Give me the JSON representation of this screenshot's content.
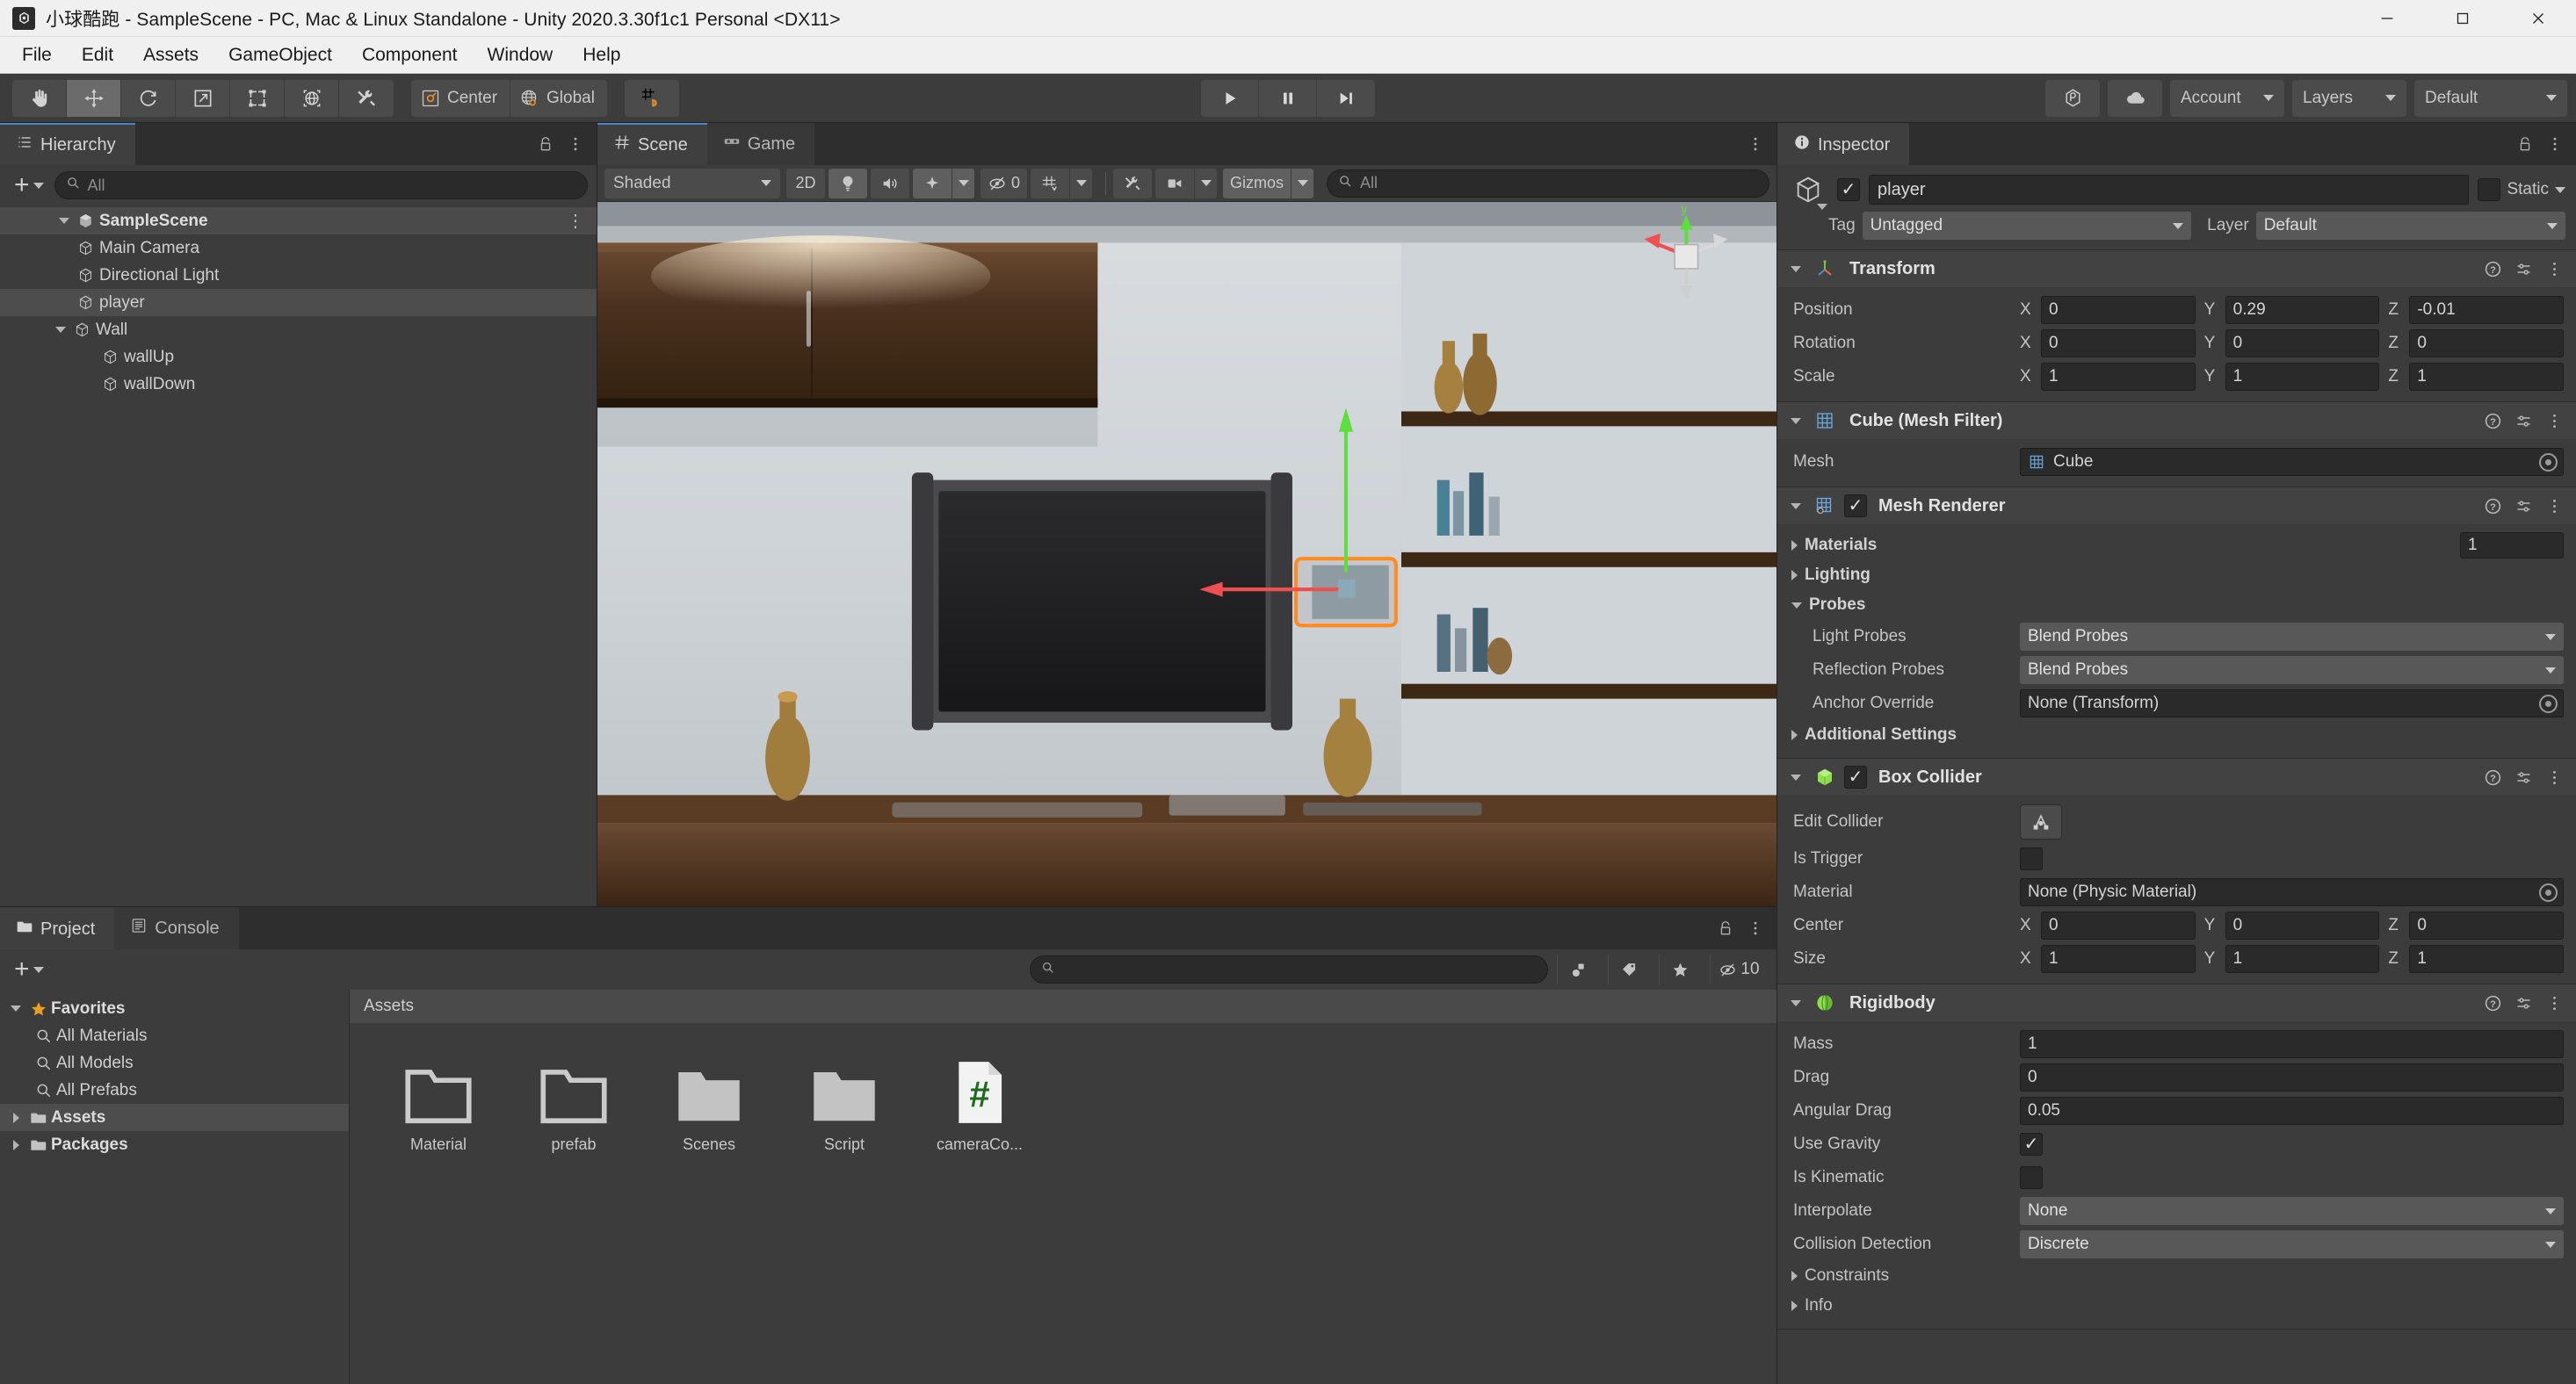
{
  "window": {
    "title": "小球酷跑 - SampleScene - PC, Mac & Linux Standalone - Unity 2020.3.30f1c1 Personal <DX11>",
    "app_icon": "unity-icon",
    "minimize": "minimize-icon",
    "maximize": "maximize-icon",
    "close": "close-icon"
  },
  "menubar": {
    "items": [
      "File",
      "Edit",
      "Assets",
      "GameObject",
      "Component",
      "Window",
      "Help"
    ]
  },
  "toolbar": {
    "tools": [
      {
        "name": "hand-tool",
        "active": false
      },
      {
        "name": "move-tool",
        "active": true
      },
      {
        "name": "rotate-tool",
        "active": false
      },
      {
        "name": "scale-tool",
        "active": false
      },
      {
        "name": "rect-tool",
        "active": false
      },
      {
        "name": "transform-tool",
        "active": false
      },
      {
        "name": "custom-editor-tool",
        "active": false
      }
    ],
    "pivot_label": "Center",
    "space_label": "Global",
    "snap_label": "grid-snap",
    "play": "play-icon",
    "pause": "pause-icon",
    "step": "step-icon",
    "collab_label": "collab-icon",
    "cloud_label": "cloud-icon",
    "account_label": "Account",
    "layers_label": "Layers",
    "layout_label": "Default"
  },
  "hierarchy": {
    "tab_label": "Hierarchy",
    "search_placeholder": "All",
    "rows": [
      {
        "label": "SampleScene",
        "depth": 0,
        "type": "scene",
        "expanded": true,
        "selected": false,
        "menu": true
      },
      {
        "label": "Main Camera",
        "depth": 1,
        "type": "object",
        "expanded": null,
        "selected": false
      },
      {
        "label": "Directional Light",
        "depth": 1,
        "type": "object",
        "expanded": null,
        "selected": false
      },
      {
        "label": "player",
        "depth": 1,
        "type": "object",
        "expanded": null,
        "selected": true
      },
      {
        "label": "Wall",
        "depth": 1,
        "type": "object",
        "expanded": true,
        "selected": false
      },
      {
        "label": "wallUp",
        "depth": 2,
        "type": "object",
        "expanded": null,
        "selected": false
      },
      {
        "label": "wallDown",
        "depth": 2,
        "type": "object",
        "expanded": null,
        "selected": false
      }
    ]
  },
  "scene": {
    "tabs": [
      {
        "label": "Scene",
        "icon": "scene-grid-icon",
        "active": true
      },
      {
        "label": "Game",
        "icon": "game-pad-icon",
        "active": false
      }
    ],
    "draw_mode": "Shaded",
    "two_d_label": "2D",
    "lighting_icon": "lighting-bulb-icon",
    "audio_icon": "audio-speaker-icon",
    "fx_icon": "effects-icon",
    "hidden_count": "0",
    "grid_icon": "grid-visibility-icon",
    "tools_icon": "scene-tools-icon",
    "camera_icon": "scene-camera-icon",
    "gizmos_label": "Gizmos",
    "search_placeholder": "All"
  },
  "project": {
    "tabs": [
      {
        "label": "Project",
        "icon": "folder-icon",
        "active": true
      },
      {
        "label": "Console",
        "icon": "console-icon",
        "active": false
      }
    ],
    "search_placeholder": "",
    "hidden_count": "10",
    "tree": [
      {
        "label": "Favorites",
        "depth": 0,
        "icon": "star-icon",
        "expanded": true,
        "bold": true,
        "selected": false
      },
      {
        "label": "All Materials",
        "depth": 1,
        "icon": "search-icon",
        "expanded": null,
        "bold": false,
        "selected": false
      },
      {
        "label": "All Models",
        "depth": 1,
        "icon": "search-icon",
        "expanded": null,
        "bold": false,
        "selected": false
      },
      {
        "label": "All Prefabs",
        "depth": 1,
        "icon": "search-icon",
        "expanded": null,
        "bold": false,
        "selected": false
      },
      {
        "label": "Assets",
        "depth": 0,
        "icon": "folder-icon",
        "expanded": false,
        "bold": true,
        "selected": true
      },
      {
        "label": "Packages",
        "depth": 0,
        "icon": "folder-icon",
        "expanded": false,
        "bold": true,
        "selected": false
      }
    ],
    "breadcrumb": "Assets",
    "assets": [
      {
        "label": "Material",
        "type": "folder-empty"
      },
      {
        "label": "prefab",
        "type": "folder-empty"
      },
      {
        "label": "Scenes",
        "type": "folder-full"
      },
      {
        "label": "Script",
        "type": "folder-full"
      },
      {
        "label": "cameraCo...",
        "type": "csharp-script"
      }
    ]
  },
  "inspector": {
    "tab_label": "Inspector",
    "object_enabled": true,
    "object_name": "player",
    "static_label": "Static",
    "static_checked": false,
    "tag_label": "Tag",
    "tag_value": "Untagged",
    "layer_label": "Layer",
    "layer_value": "Default",
    "components": [
      {
        "name": "Transform",
        "icon": "transform-icon",
        "has_checkbox": false,
        "expanded": true,
        "vectors": [
          {
            "label": "Position",
            "x": "0",
            "y": "0.29",
            "z": "-0.01"
          },
          {
            "label": "Rotation",
            "x": "0",
            "y": "0",
            "z": "0"
          },
          {
            "label": "Scale",
            "x": "1",
            "y": "1",
            "z": "1"
          }
        ]
      },
      {
        "name": "Cube (Mesh Filter)",
        "icon": "mesh-filter-icon",
        "has_checkbox": false,
        "expanded": true,
        "mesh_label": "Mesh",
        "mesh_value": "Cube"
      },
      {
        "name": "Mesh Renderer",
        "icon": "mesh-renderer-icon",
        "has_checkbox": true,
        "checked": true,
        "expanded": true,
        "materials_label": "Materials",
        "materials_count": "1",
        "lighting_label": "Lighting",
        "probes_label": "Probes",
        "light_probes_label": "Light Probes",
        "light_probes_value": "Blend Probes",
        "reflection_probes_label": "Reflection Probes",
        "reflection_probes_value": "Blend Probes",
        "anchor_label": "Anchor Override",
        "anchor_value": "None (Transform)",
        "additional_label": "Additional Settings"
      },
      {
        "name": "Box Collider",
        "icon": "box-collider-icon",
        "has_checkbox": true,
        "checked": true,
        "expanded": true,
        "edit_collider_label": "Edit Collider",
        "is_trigger_label": "Is Trigger",
        "is_trigger_checked": false,
        "material_label": "Material",
        "material_value": "None (Physic Material)",
        "center": {
          "label": "Center",
          "x": "0",
          "y": "0",
          "z": "0"
        },
        "size": {
          "label": "Size",
          "x": "1",
          "y": "1",
          "z": "1"
        }
      },
      {
        "name": "Rigidbody",
        "icon": "rigidbody-icon",
        "has_checkbox": false,
        "expanded": true,
        "mass_label": "Mass",
        "mass_value": "1",
        "drag_label": "Drag",
        "drag_value": "0",
        "angular_drag_label": "Angular Drag",
        "angular_drag_value": "0.05",
        "use_gravity_label": "Use Gravity",
        "use_gravity_checked": true,
        "is_kinematic_label": "Is Kinematic",
        "is_kinematic_checked": false,
        "interpolate_label": "Interpolate",
        "interpolate_value": "None",
        "collision_label": "Collision Detection",
        "collision_value": "Discrete",
        "constraints_label": "Constraints",
        "info_label": "Info"
      }
    ]
  },
  "colors": {
    "unity_bg": "#383838",
    "panel_bg": "#3c3c3c",
    "accent_blue": "#4b86c9",
    "selection_orange": "#ff8b22",
    "gizmo_green": "#5ddf3e",
    "gizmo_red": "#ef4f4f",
    "favorites_star": "#e8a020"
  }
}
